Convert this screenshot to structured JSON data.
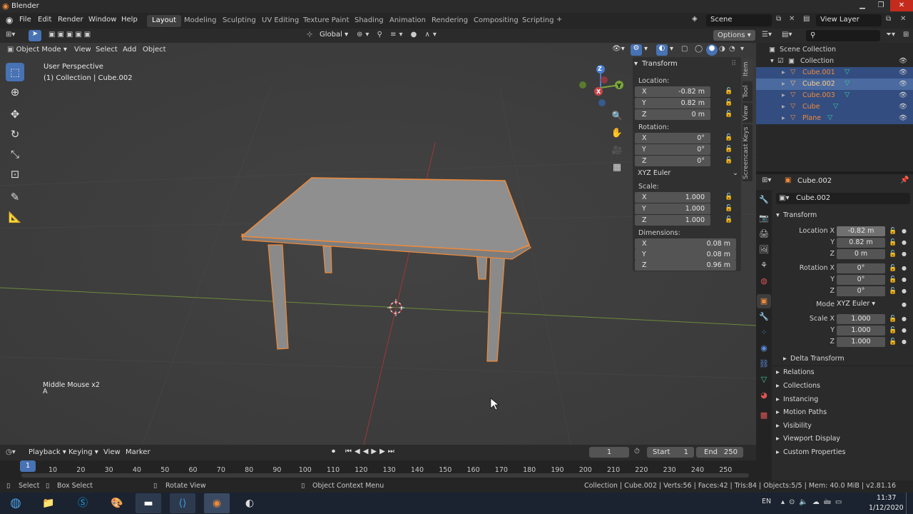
{
  "window": {
    "title": "Blender"
  },
  "menus": [
    "File",
    "Edit",
    "Render",
    "Window",
    "Help"
  ],
  "workspaces": [
    "Layout",
    "Modeling",
    "Sculpting",
    "UV Editing",
    "Texture Paint",
    "Shading",
    "Animation",
    "Rendering",
    "Compositing",
    "Scripting"
  ],
  "active_workspace": "Layout",
  "add_workspace": "+",
  "scene": "Scene",
  "view_layer": "View Layer",
  "header": {
    "transform_orientation": "Global",
    "options": "Options",
    "mode": "Object Mode",
    "menu_items": [
      "View",
      "Select",
      "Add",
      "Object"
    ]
  },
  "viewport": {
    "perspective": "User Perspective",
    "collection_info": "(1) Collection | Cube.002",
    "screencast_line1": "Middle Mouse x2",
    "screencast_line2": "A",
    "gizmo": {
      "x": "X",
      "y": "Y",
      "z": "Z"
    }
  },
  "npanel": {
    "header": "Transform",
    "location_label": "Location:",
    "location": [
      {
        "k": "X",
        "v": "-0.82 m"
      },
      {
        "k": "Y",
        "v": "0.82 m"
      },
      {
        "k": "Z",
        "v": "0 m"
      }
    ],
    "rotation_label": "Rotation:",
    "rotation": [
      {
        "k": "X",
        "v": "0°"
      },
      {
        "k": "Y",
        "v": "0°"
      },
      {
        "k": "Z",
        "v": "0°"
      }
    ],
    "rotation_mode": "XYZ Euler",
    "scale_label": "Scale:",
    "scale": [
      {
        "k": "X",
        "v": "1.000"
      },
      {
        "k": "Y",
        "v": "1.000"
      },
      {
        "k": "Z",
        "v": "1.000"
      }
    ],
    "dimensions_label": "Dimensions:",
    "dimensions": [
      {
        "k": "X",
        "v": "0.08 m"
      },
      {
        "k": "Y",
        "v": "0.08 m"
      },
      {
        "k": "Z",
        "v": "0.96 m"
      }
    ],
    "tabs": [
      "Item",
      "Tool",
      "View",
      "Screencast Keys"
    ]
  },
  "outliner": {
    "root": "Scene Collection",
    "collection": "Collection",
    "items": [
      "Cube.001",
      "Cube.002",
      "Cube.003",
      "Cube",
      "Plane"
    ]
  },
  "properties": {
    "object_name": "Cube.002",
    "object_field": "Cube.002",
    "transform_header": "Transform",
    "location_x_label": "Location X",
    "y_label": "Y",
    "z_label": "Z",
    "location": [
      "-0.82 m",
      "0.82 m",
      "0 m"
    ],
    "rotation_x_label": "Rotation X",
    "rotation": [
      "0°",
      "0°",
      "0°"
    ],
    "mode_label": "Mode",
    "mode_value": "XYZ Euler",
    "scale_x_label": "Scale X",
    "scale": [
      "1.000",
      "1.000",
      "1.000"
    ],
    "delta_transform": "Delta Transform",
    "sections": [
      "Relations",
      "Collections",
      "Instancing",
      "Motion Paths",
      "Visibility",
      "Viewport Display",
      "Custom Properties"
    ]
  },
  "timeline": {
    "menus": [
      "Playback",
      "Keying",
      "View",
      "Marker"
    ],
    "current_frame": "1",
    "start_label": "Start",
    "start": "1",
    "end_label": "End",
    "end": "250",
    "ticks": [
      "1",
      "10",
      "20",
      "30",
      "40",
      "50",
      "60",
      "70",
      "80",
      "90",
      "100",
      "110",
      "120",
      "130",
      "140",
      "150",
      "160",
      "170",
      "180",
      "190",
      "200",
      "210",
      "220",
      "230",
      "240",
      "250"
    ]
  },
  "status": {
    "select": "Select",
    "box_select": "Box Select",
    "rotate_view": "Rotate View",
    "context_menu": "Object Context Menu",
    "info": "Collection | Cube.002 | Verts:56 | Faces:42 | Tris:84 | Objects:5/5 | Mem: 40.0 MiB | v2.81.16"
  },
  "taskbar": {
    "lang": "EN",
    "time": "11:37",
    "date": "1/12/2020"
  },
  "colors": {
    "accent": "#4772b3",
    "selection_outline": "#f08a3a",
    "active_tab": "#3f3f3f"
  }
}
